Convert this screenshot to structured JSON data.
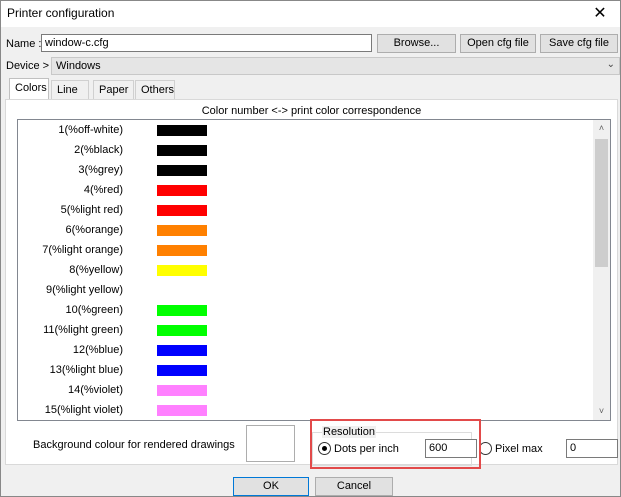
{
  "window": {
    "title": "Printer configuration",
    "close_symbol": "✕"
  },
  "name_row": {
    "label": "Name :",
    "value": "window-c.cfg",
    "browse_label": "Browse...",
    "open_label": "Open cfg file",
    "save_label": "Save cfg file"
  },
  "device_row": {
    "label": "Device >",
    "value": "Windows",
    "arrow_icon": "chevron-down-icon"
  },
  "tabs": [
    {
      "label": "Colors",
      "active": true
    },
    {
      "label": "Line",
      "active": false
    },
    {
      "label": "Paper",
      "active": false
    },
    {
      "label": "Others",
      "active": false
    }
  ],
  "colors_panel": {
    "heading": "Color number <-> print color correspondence",
    "rows": [
      {
        "label": "1(%off-white)",
        "color": "#000000"
      },
      {
        "label": "2(%black)",
        "color": "#000000"
      },
      {
        "label": "3(%grey)",
        "color": "#000000"
      },
      {
        "label": "4(%red)",
        "color": "#ff0000"
      },
      {
        "label": "5(%light red)",
        "color": "#ff0000"
      },
      {
        "label": "6(%orange)",
        "color": "#ff8000"
      },
      {
        "label": "7(%light orange)",
        "color": "#ff8000"
      },
      {
        "label": "8(%yellow)",
        "color": "#ffff00"
      },
      {
        "label": "9(%light yellow)",
        "color": ""
      },
      {
        "label": "10(%green)",
        "color": "#00ff00"
      },
      {
        "label": "11(%light green)",
        "color": "#00ff00"
      },
      {
        "label": "12(%blue)",
        "color": "#0000ff"
      },
      {
        "label": "13(%light blue)",
        "color": "#0000ff"
      },
      {
        "label": "14(%violet)",
        "color": "#ff80ff"
      },
      {
        "label": "15(%light violet)",
        "color": "#ff80ff"
      }
    ],
    "scroll_up_icon": "˄",
    "scroll_down_icon": "˅"
  },
  "background": {
    "label": "Background colour for rendered drawings",
    "color": "#ffffff"
  },
  "resolution": {
    "title": "Resolution",
    "dpi_label": "Dots per inch",
    "dpi_value": "600",
    "dpi_selected": true,
    "pixel_label": "Pixel max",
    "pixel_value": "0",
    "pixel_selected": false,
    "highlight_color": "#e24a4a"
  },
  "footer": {
    "ok_label": "OK",
    "cancel_label": "Cancel"
  }
}
